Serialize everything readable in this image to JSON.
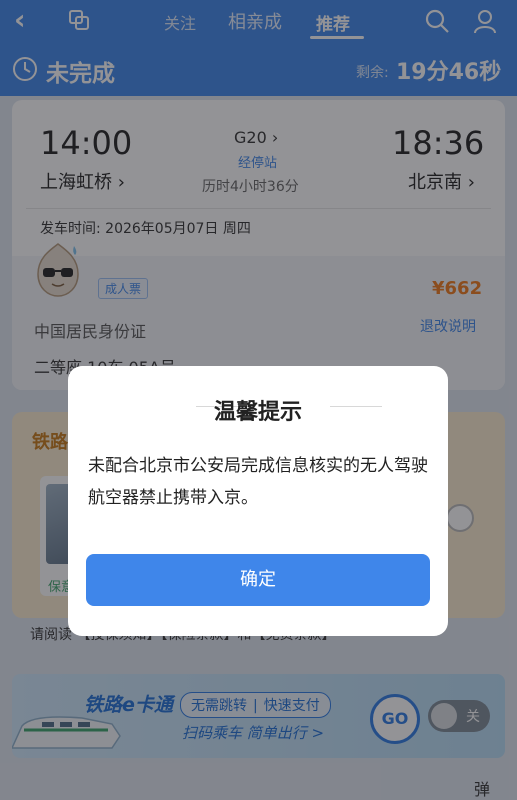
{
  "header": {
    "tabs": [
      "关注",
      "相亲成",
      "推荐"
    ]
  },
  "status": {
    "title": "未完成",
    "remain_label": "剩余:",
    "remain_time": "19分46秒"
  },
  "ticket": {
    "departure_time": "14:00",
    "arrival_time": "18:36",
    "train_no": "G20 ›",
    "stops_link": "经停站",
    "departure_station": "上海虹桥 ›",
    "arrival_station": "北京南 ›",
    "duration": "历时4小时36分",
    "departure_date": "发车时间: 2026年05月07日 周四",
    "ticket_type": "成人票",
    "price": "¥662",
    "id_type": "中国居民身份证",
    "refund_link": "退改说明",
    "seat": "二等座 10车 05A号"
  },
  "insurance": {
    "title": "铁路",
    "card_label": "保意",
    "agreement": "请阅读 【投保须知】【保险条款】和【免责条款】"
  },
  "banner": {
    "logo": "铁路e卡通",
    "tag1": "无需跳转",
    "tag2": "快速支付",
    "subtitle": "扫码乘车 简单出行 >",
    "go": "GO",
    "toggle_label": "关"
  },
  "corner_text": "弹",
  "dialog": {
    "title": "温馨提示",
    "message": "未配合北京市公安局完成信息核实的无人驾驶航空器禁止携带入京。",
    "confirm": "确定"
  },
  "colors": {
    "primary": "#3f86ea",
    "price": "#f07a1a",
    "insurance_bg": "#fbecd0"
  }
}
